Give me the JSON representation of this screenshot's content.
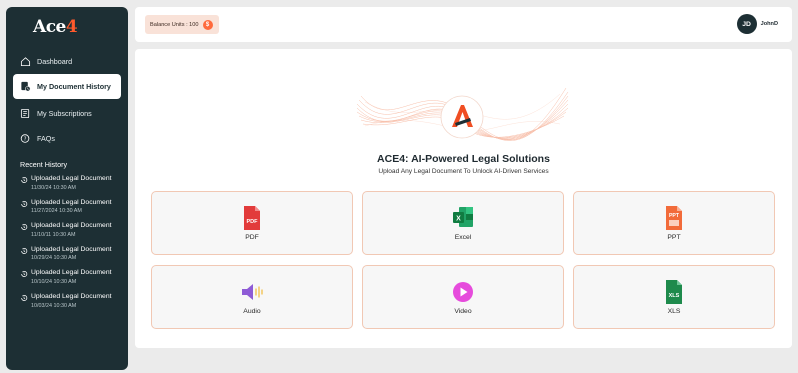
{
  "brand": {
    "logo_text_a": "Ace",
    "logo_text_b": "4"
  },
  "sidebar": {
    "items": [
      {
        "label": "Dashboard",
        "icon": "home-icon"
      },
      {
        "label": "My Document History",
        "icon": "document-history-icon",
        "active": true
      },
      {
        "label": "My Subscriptions",
        "icon": "subscriptions-icon"
      },
      {
        "label": "FAQs",
        "icon": "faq-icon"
      }
    ],
    "recent_title": "Recent History",
    "recent": [
      {
        "title": "Uploaded Legal Document",
        "time": "11/30/24 10:30 AM"
      },
      {
        "title": "Uploaded Legal Document",
        "time": "11/27/2024 10:30 AM"
      },
      {
        "title": "Uploaded Legal Document",
        "time": "11/10/11 10:30 AM"
      },
      {
        "title": "Uploaded Legal Document",
        "time": "10/29/24 10:30 AM"
      },
      {
        "title": "Uploaded Legal Document",
        "time": "10/10/24 10:30 AM"
      },
      {
        "title": "Uploaded Legal Document",
        "time": "10/03/24 10:30 AM"
      }
    ]
  },
  "header": {
    "balance_label": "Balance Units : 100",
    "user_initials": "JD",
    "user_name": "JohnD"
  },
  "main": {
    "title": "ACE4: AI-Powered Legal Solutions",
    "subtitle": "Upload Any Legal Document To Unlock AI-Driven Services",
    "cards": [
      {
        "label": "PDF",
        "icon": "pdf-icon"
      },
      {
        "label": "Excel",
        "icon": "excel-icon"
      },
      {
        "label": "PPT",
        "icon": "ppt-icon"
      },
      {
        "label": "Audio",
        "icon": "audio-icon"
      },
      {
        "label": "Video",
        "icon": "video-icon"
      },
      {
        "label": "XLS",
        "icon": "xls-icon"
      }
    ]
  },
  "colors": {
    "sidebar_bg": "#1d2f34",
    "accent": "#ff5a2c",
    "card_border": "#f1c8b4",
    "balance_bg": "#f9e2d8"
  }
}
